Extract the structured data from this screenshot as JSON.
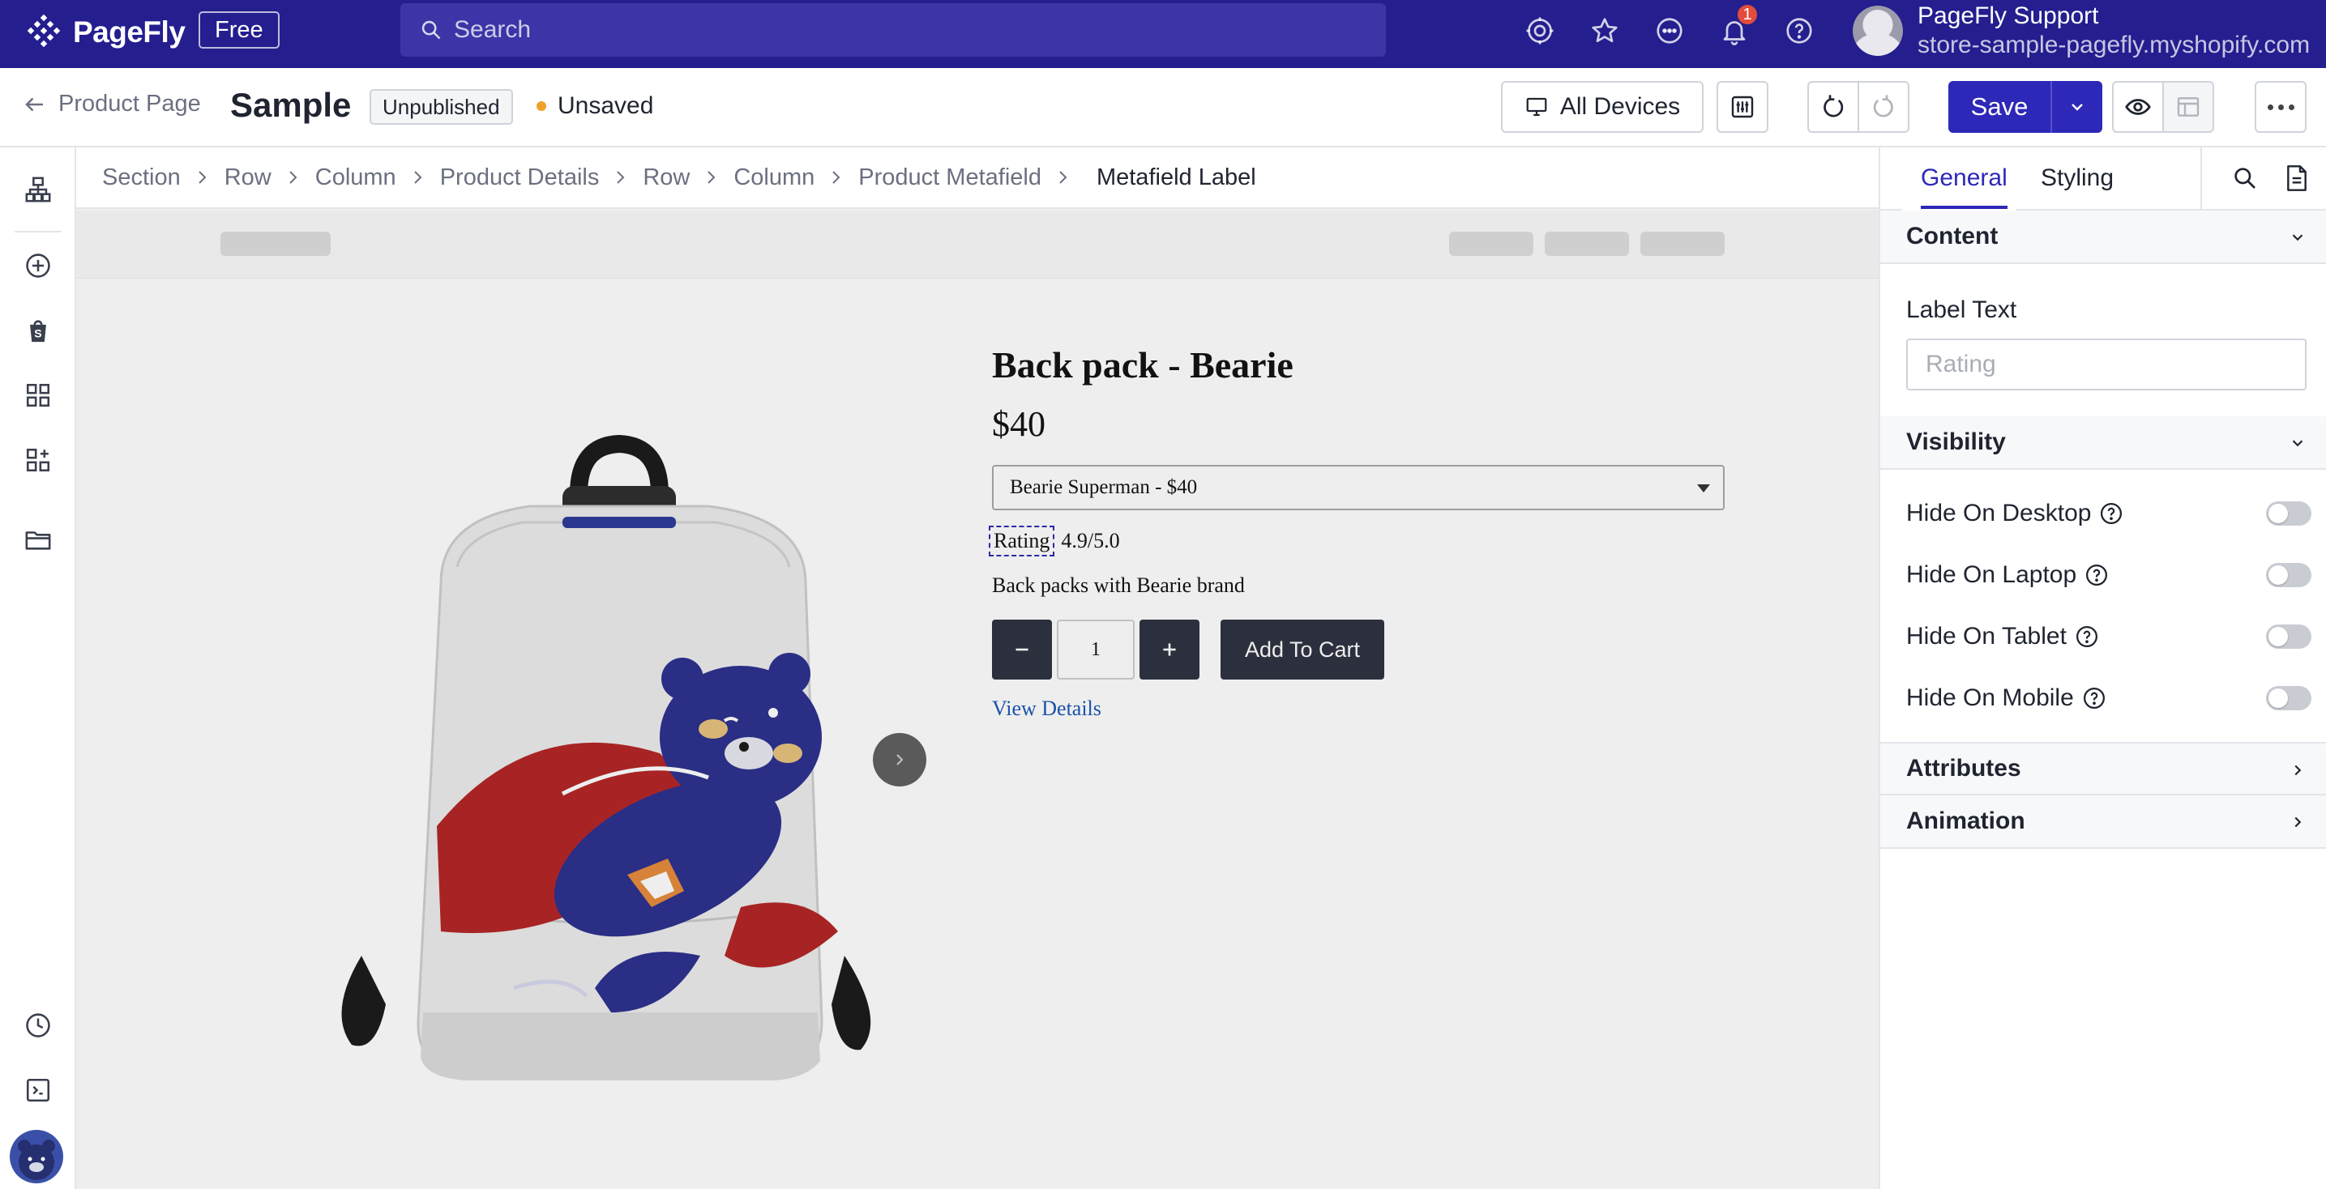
{
  "topbar": {
    "brand": "PageFly",
    "plan_badge": "Free",
    "search_placeholder": "Search",
    "notification_count": "1",
    "user_name": "PageFly Support",
    "user_store": "store-sample-pagefly.myshopify.com"
  },
  "header": {
    "back_label": "Product Page",
    "page_name": "Sample",
    "status_badge": "Unpublished",
    "save_status": "Unsaved",
    "devices_label": "All Devices",
    "save_label": "Save"
  },
  "breadcrumb": {
    "items": [
      "Section",
      "Row",
      "Column",
      "Product Details",
      "Row",
      "Column",
      "Product Metafield"
    ],
    "active": "Metafield Label"
  },
  "product": {
    "title": "Back pack - Bearie",
    "price": "$40",
    "variant": "Bearie Superman - $40",
    "meta_label": "Rating",
    "meta_value": "4.9/5.0",
    "description": "Back packs with Bearie brand",
    "quantity": "1",
    "add_to_cart": "Add To Cart",
    "view_details": "View Details"
  },
  "panel": {
    "tabs": [
      "General",
      "Styling"
    ],
    "active_tab": "General",
    "sections": {
      "content": "Content",
      "visibility": "Visibility",
      "attributes": "Attributes",
      "animation": "Animation"
    },
    "label_text": {
      "label": "Label Text",
      "placeholder": "Rating"
    },
    "visibility_toggles": [
      {
        "label": "Hide On Desktop",
        "on": false
      },
      {
        "label": "Hide On Laptop",
        "on": false
      },
      {
        "label": "Hide On Tablet",
        "on": false
      },
      {
        "label": "Hide On Mobile",
        "on": false
      }
    ]
  },
  "colors": {
    "topbar": "#241e8f",
    "primary": "#2e28b8",
    "unsaved_dot": "#f0a028",
    "dark_button": "#2d3140"
  },
  "icons": {
    "topbar": [
      "target-icon",
      "star-icon",
      "chat-icon",
      "bell-icon",
      "help-icon"
    ],
    "left_rail": [
      "sitemap-icon",
      "add-circle-icon",
      "shopify-bag-icon",
      "grid-icon",
      "add-grid-icon",
      "folder-icon",
      "history-icon",
      "terminal-icon"
    ]
  }
}
